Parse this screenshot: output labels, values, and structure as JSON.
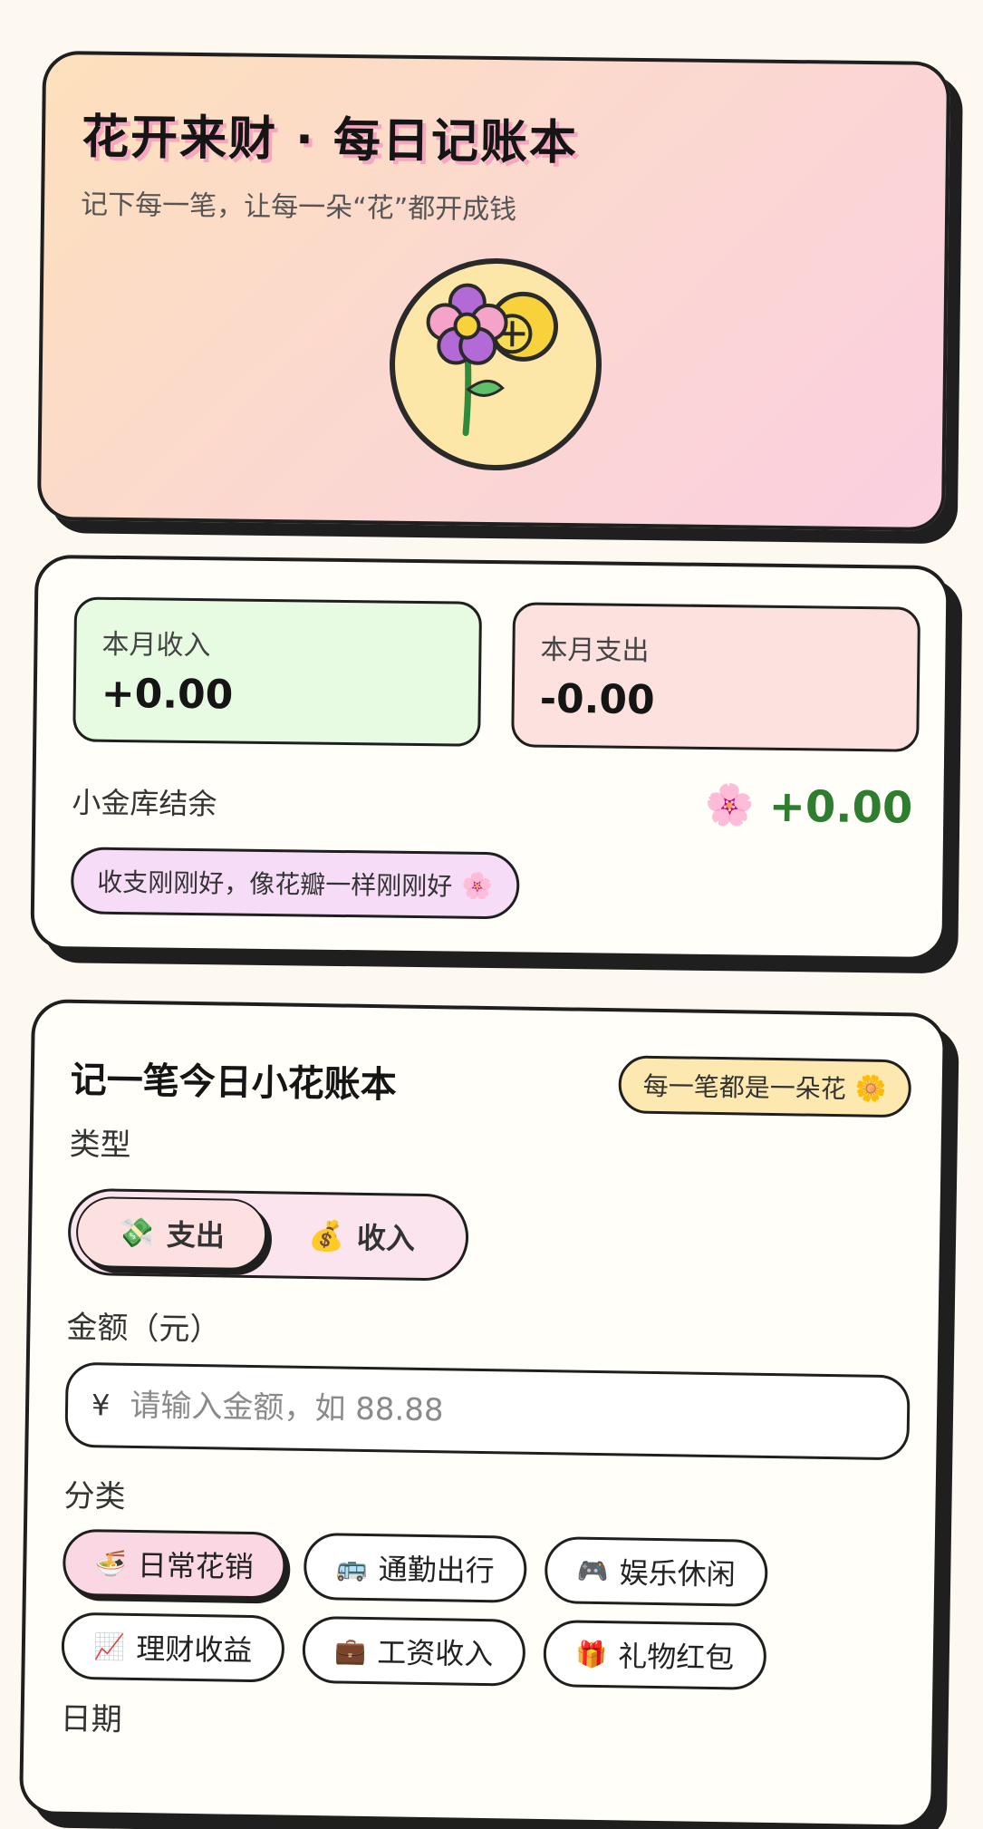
{
  "hero": {
    "title": "花开来财 · 每日记账本",
    "subtitle": "记下每一笔，让每一朵“花”都开成钱",
    "logo_icon": "flower-coin-icon"
  },
  "summary": {
    "income_label": "本月收入",
    "income_value": "+0.00",
    "expense_label": "本月支出",
    "expense_value": "-0.00",
    "balance_label": "小金库结余",
    "balance_icon": "🌸",
    "balance_value": "+0.00",
    "hint_text": "收支刚刚好，像花瓣一样刚刚好",
    "hint_icon": "🌸",
    "colors": {
      "income_bg": "#e6fbe1",
      "expense_bg": "#fde1df",
      "balance": "#2f7d2f"
    }
  },
  "entry": {
    "title": "记一笔今日小花账本",
    "badge_text": "每一笔都是一朵花",
    "badge_icon": "🌼",
    "type_label": "类型",
    "types": [
      {
        "icon": "💸",
        "label": "支出",
        "active": true
      },
      {
        "icon": "💰",
        "label": "收入",
        "active": false
      }
    ],
    "amount_label": "金额（元）",
    "currency_symbol": "¥",
    "amount_placeholder": "请输入金额，如 88.88",
    "amount_value": "",
    "category_label": "分类",
    "categories": [
      {
        "icon": "🍜",
        "label": "日常花销",
        "active": true
      },
      {
        "icon": "🚌",
        "label": "通勤出行",
        "active": false
      },
      {
        "icon": "🎮",
        "label": "娱乐休闲",
        "active": false
      },
      {
        "icon": "📈",
        "label": "理财收益",
        "active": false
      },
      {
        "icon": "💼",
        "label": "工资收入",
        "active": false
      },
      {
        "icon": "🎁",
        "label": "礼物红包",
        "active": false
      }
    ],
    "date_label": "日期"
  }
}
